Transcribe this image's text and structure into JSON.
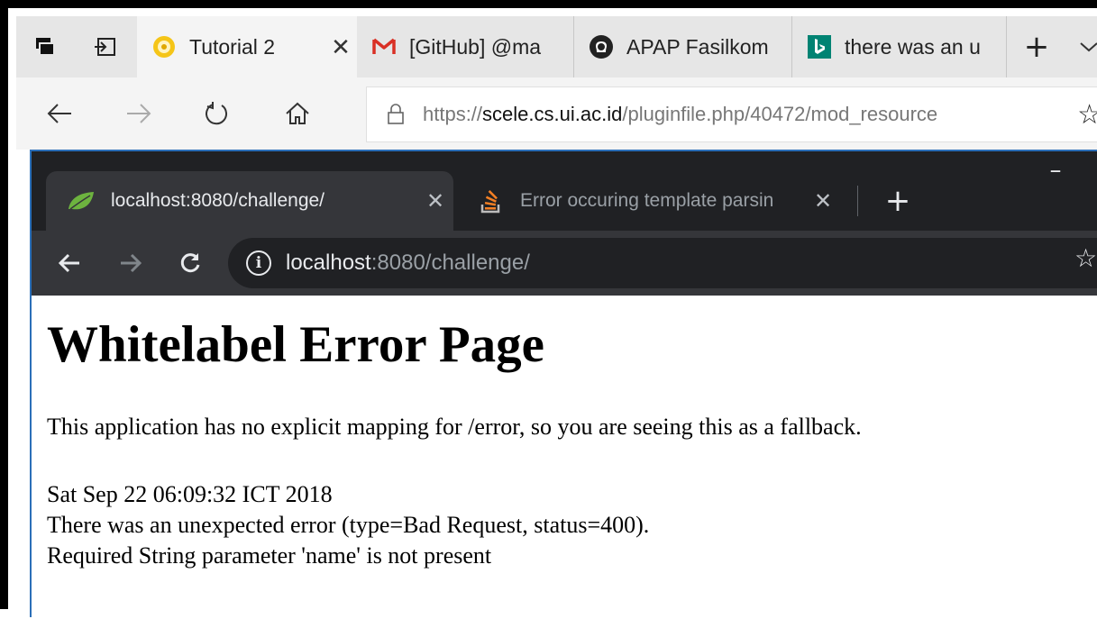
{
  "edge": {
    "tabs": [
      {
        "title": "Tutorial 2",
        "icon": "ui-logo-icon",
        "active": true
      },
      {
        "title": "[GitHub] @ma",
        "icon": "gmail-icon",
        "active": false
      },
      {
        "title": "APAP Fasilkom",
        "icon": "github-icon",
        "active": false
      },
      {
        "title": "there was an u",
        "icon": "bing-icon",
        "active": false
      }
    ],
    "close_glyph": "✕",
    "new_tab_glyph": "+",
    "url": {
      "scheme": "https://",
      "host": "scele.cs.ui.ac.id",
      "path": "/pluginfile.php/40472/mod_resource"
    }
  },
  "chrome": {
    "tabs": [
      {
        "title": "localhost:8080/challenge/",
        "icon": "spring-leaf-icon",
        "active": true
      },
      {
        "title": "Error occuring template parsin",
        "icon": "stackoverflow-icon",
        "active": false
      }
    ],
    "close_glyph": "✕",
    "new_tab_glyph": "+",
    "minimize_glyph": "–",
    "url": {
      "host": "localhost",
      "rest": ":8080/challenge/"
    }
  },
  "page": {
    "heading": "Whitelabel Error Page",
    "message": "This application has no explicit mapping for /error, so you are seeing this as a fallback.",
    "timestamp": "Sat Sep 22 06:09:32 ICT 2018",
    "error": "There was an unexpected error (type=Bad Request, status=400).",
    "detail": "Required String parameter 'name' is not present"
  },
  "colors": {
    "chrome_tabstrip": "#202124",
    "chrome_toolbar": "#35363a",
    "edge_tabstrip": "#e6e6e6",
    "edge_toolbar": "#f4f4f4",
    "gmail_red": "#d93025",
    "bing_teal": "#008373",
    "spring_green": "#6db33f",
    "stackoverflow_orange": "#f48024"
  }
}
